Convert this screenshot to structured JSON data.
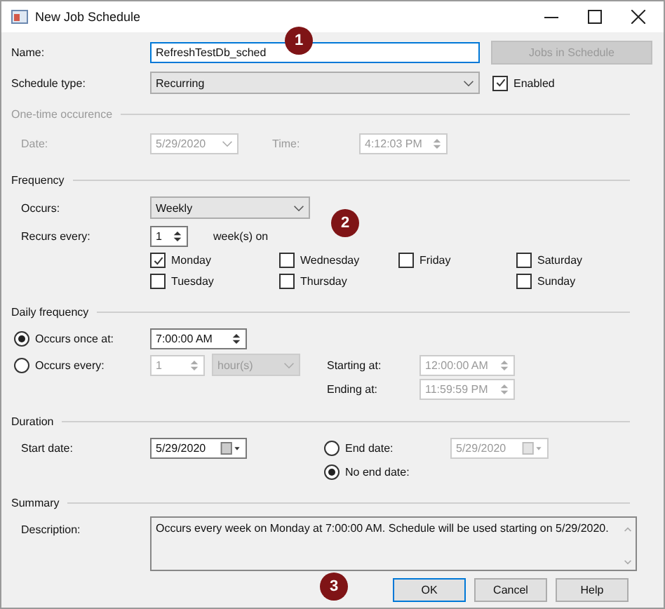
{
  "window": {
    "title": "New Job Schedule"
  },
  "name": {
    "label": "Name:",
    "value": "RefreshTestDb_sched"
  },
  "jobs_button": {
    "label": "Jobs in Schedule",
    "disabled": true
  },
  "schedule_type": {
    "label": "Schedule type:",
    "value": "Recurring"
  },
  "enabled": {
    "label": "Enabled",
    "checked": true
  },
  "one_time": {
    "title": "One-time occurence",
    "disabled": true,
    "date": {
      "label": "Date:",
      "value": "5/29/2020"
    },
    "time": {
      "label": "Time:",
      "value": "4:12:03 PM"
    }
  },
  "frequency": {
    "title": "Frequency",
    "occurs": {
      "label": "Occurs:",
      "value": "Weekly"
    },
    "recurs_every": {
      "label": "Recurs every:",
      "value": "1",
      "unit": "week(s) on"
    },
    "days": [
      {
        "label": "Monday",
        "checked": true
      },
      {
        "label": "Wednesday",
        "checked": false
      },
      {
        "label": "Friday",
        "checked": false
      },
      {
        "label": "Saturday",
        "checked": false
      },
      {
        "label": "Tuesday",
        "checked": false
      },
      {
        "label": "Thursday",
        "checked": false
      },
      {
        "label": "Sunday",
        "checked": false
      }
    ]
  },
  "daily_frequency": {
    "title": "Daily frequency",
    "options": [
      {
        "kind": "once",
        "label": "Occurs once at:",
        "selected": true,
        "value": "7:00:00 AM"
      },
      {
        "kind": "every",
        "label": "Occurs every:",
        "selected": false,
        "value": "1",
        "unit": "hour(s)",
        "starting": {
          "label": "Starting at:",
          "value": "12:00:00 AM"
        },
        "ending": {
          "label": "Ending at:",
          "value": "11:59:59 PM"
        }
      }
    ]
  },
  "duration": {
    "title": "Duration",
    "start_date": {
      "label": "Start date:",
      "value": "5/29/2020"
    },
    "end_options": [
      {
        "kind": "end_date",
        "label": "End date:",
        "selected": false,
        "value": "5/29/2020"
      },
      {
        "kind": "no_end",
        "label": "No end date:",
        "selected": true
      }
    ]
  },
  "summary": {
    "title": "Summary",
    "description": {
      "label": "Description:",
      "value": "Occurs every week on Monday at 7:00:00 AM. Schedule will be used starting on 5/29/2020."
    }
  },
  "buttons": [
    {
      "label": "OK",
      "default": true
    },
    {
      "label": "Cancel",
      "default": false
    },
    {
      "label": "Help",
      "default": false
    }
  ],
  "callouts": [
    "1",
    "2",
    "3"
  ]
}
